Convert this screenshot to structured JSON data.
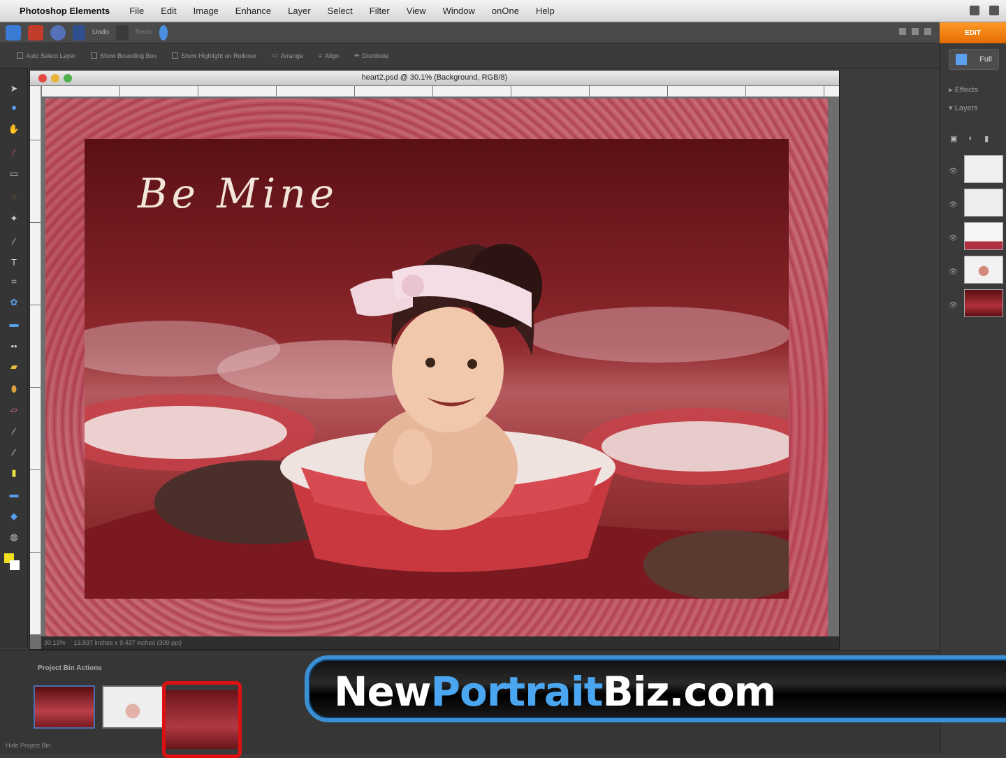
{
  "menubar": {
    "app_name": "Photoshop Elements",
    "items": [
      "File",
      "Edit",
      "Image",
      "Enhance",
      "Layer",
      "Select",
      "Filter",
      "View",
      "Window",
      "onOne",
      "Help"
    ]
  },
  "toolbar": {
    "undo_label": "Undo",
    "redo_label": "Redo",
    "edit_tab": "EDIT"
  },
  "options": {
    "items": [
      "Auto Select Layer",
      "Show Bounding Box",
      "Show Highlight on Rollover",
      "Arrange",
      "Align",
      "Distribute"
    ]
  },
  "document": {
    "title": "heart2.psd @ 30.1% (Background, RGB/8)",
    "overlay_text": "Be Mine",
    "status_zoom": "30.13%",
    "status_info": "13.937 inches x 9.437 inches (300 ppi)"
  },
  "right_panel": {
    "tab_label": "Full",
    "sections": [
      "Effects",
      "Layers"
    ]
  },
  "project_bin": {
    "label": "Project Bin Actions",
    "footer": "Hide Project Bin"
  },
  "banner": {
    "part1": "New",
    "part2": "Portrait",
    "part3": "Biz.com"
  },
  "colors": {
    "accent_orange": "#e8780c",
    "banner_blue": "#3b8fd4",
    "highlight_red": "#d11111"
  }
}
